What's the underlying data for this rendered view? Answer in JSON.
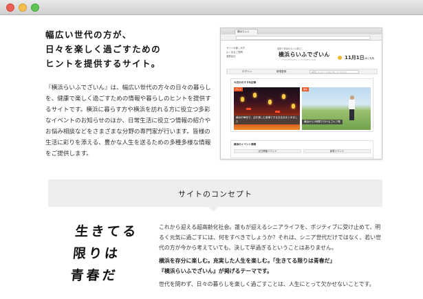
{
  "window": {
    "controls": [
      "close",
      "minimize",
      "maximize"
    ]
  },
  "headline": [
    "幅広い世代の方が、",
    "日々を楽しく過ごすための",
    "ヒントを提供するサイト。"
  ],
  "intro": "『横浜らいふでざいん』は、幅広い世代の方々の日々の暮らしを、健康で楽しく過ごすための情報や暮らしのヒントを提供するサイトです。横浜に暮らす方や横浜を訪れる方に役立つ多彩なイベントのお知らせのほか、日常生活に役立つ情報の紹介やお悩み相談などをさまざまな分野の専門家が行います。皆様の生活に彩りを添える、豊かな人生を送るための多種多様な情報をご提供します。",
  "mockup": {
    "tab_label": "横浜らいふ",
    "nav_links": [
      "サイトの楽しみ方",
      "よくあるご質問",
      "運営会社"
    ],
    "logo_tagline": "健康で快適な大人の暮らし",
    "logo": "横浜らいふでざいん",
    "logo_sub": "YOKOHAMA LIFEDESIGN",
    "date": "11月1日",
    "date_sub": "(水) 天気",
    "menu": [
      "ログイン",
      "新規登録"
    ],
    "search_placeholder": "検索したいワードを入力してください",
    "panel_title": "今日のおすすめ記事",
    "card1_caption": "横浜中華街で、活を楽しむ食事できるお店あまとめました",
    "card1_badge": "グルメ",
    "card2_caption": "横浜から1時間で行けるゴルフ場",
    "card2_badge": "趣味",
    "event_title": "横浜のイベント情報",
    "event_tabs": [
      "近日開催イベント",
      "新着イベント"
    ]
  },
  "concept": {
    "title": "サイトのコンセプト",
    "calligraphy": [
      "生きてる",
      "限りは",
      "青春だ"
    ],
    "paragraph1": "これから迎える超高齢化社会。誰もが迎えるシニアライフを、ポジティブに受け止めて、明るく元気に過ごすには、何をすべきでしょうか？それは、シニア世代だけではなく、若い世代の方が今から考えていても、決して早過ぎるということはありません。",
    "emphasis1": "横浜を存分に楽しむ。充実した人生を楽しむ。「生きてる限りは青春だ」",
    "emphasis2": "『横浜らいふでざいん』が掲げるテーマです。",
    "paragraph2": "世代を問わず、日々の暮らしを楽しく過ごすことは、人生にとって欠かせないことです。"
  }
}
